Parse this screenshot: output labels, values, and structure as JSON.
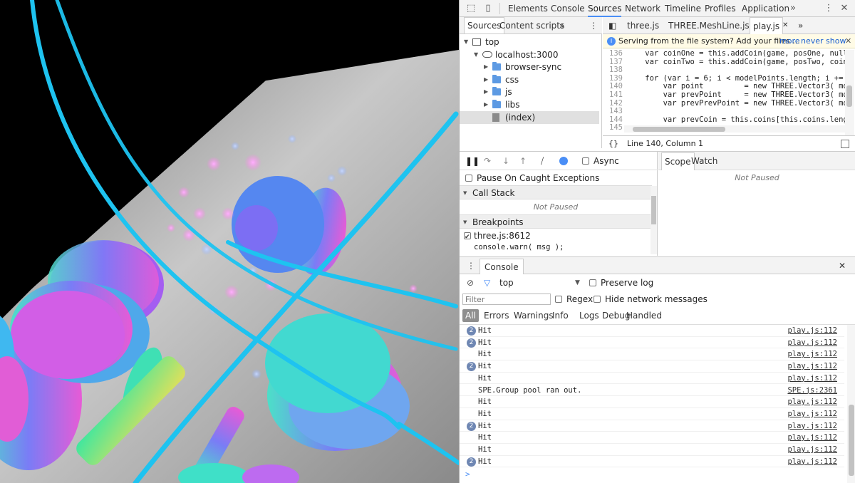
{
  "devtools": {
    "tabs": [
      "Elements",
      "Console",
      "Sources",
      "Network",
      "Timeline",
      "Profiles",
      "Application"
    ],
    "active_tab": "Sources",
    "more_tabs_icon": "»",
    "menu_icon": "⋮",
    "close_icon": "✕"
  },
  "navigator": {
    "tabs": [
      "Sources",
      "Content scripts"
    ],
    "more_icon": "»",
    "tree": [
      {
        "label": "top",
        "icon": "frame-icon",
        "depth": 0
      },
      {
        "label": "localhost:3000",
        "icon": "cloud-icon",
        "depth": 1
      },
      {
        "label": "browser-sync",
        "icon": "folder-icon",
        "depth": 2
      },
      {
        "label": "css",
        "icon": "folder-icon",
        "depth": 2
      },
      {
        "label": "js",
        "icon": "folder-icon",
        "depth": 2
      },
      {
        "label": "libs",
        "icon": "folder-icon",
        "depth": 2
      },
      {
        "label": "(index)",
        "icon": "file-icon",
        "depth": 2,
        "selected": true
      }
    ]
  },
  "editor": {
    "tabs": [
      "three.js",
      "THREE.MeshLine.js",
      "play.js"
    ],
    "active_tab": "play.js",
    "infobar_text": "Serving from the file system? Add your files ...",
    "infobar_more": "more",
    "infobar_never": "never show",
    "lines": [
      {
        "n": "136",
        "code": "    var coinOne = this.addCoin(game, posOne, null)"
      },
      {
        "n": "137",
        "code": "    var coinTwo = this.addCoin(game, posTwo, coinO"
      },
      {
        "n": "138",
        "code": ""
      },
      {
        "n": "139",
        "code": "    for (var i = 6; i < modelPoints.length; i += 3"
      },
      {
        "n": "140",
        "code": "        var point         = new THREE.Vector3( mod"
      },
      {
        "n": "141",
        "code": "        var prevPoint     = new THREE.Vector3( mod"
      },
      {
        "n": "142",
        "code": "        var prevPrevPoint = new THREE.Vector3( mod"
      },
      {
        "n": "143",
        "code": ""
      },
      {
        "n": "144",
        "code": "        var prevCoin = this.coins[this.coins.lengt"
      },
      {
        "n": "145",
        "code": ""
      }
    ],
    "status": "Line 140, Column 1",
    "format_icon": "{}"
  },
  "debugger": {
    "async_label": "Async",
    "pause_caught_label": "Pause On Caught Exceptions",
    "call_stack_label": "Call Stack",
    "call_stack_status": "Not Paused",
    "breakpoints_label": "Breakpoints",
    "breakpoint_file": "three.js:8612",
    "breakpoint_code": "console.warn( msg );",
    "scope_tab": "Scope",
    "watch_tab": "Watch",
    "scope_status": "Not Paused"
  },
  "console": {
    "title": "Console",
    "context": "top",
    "preserve_log": "Preserve log",
    "filter_placeholder": "Filter",
    "regex_label": "Regex",
    "hide_network_label": "Hide network messages",
    "levels": [
      "All",
      "Errors",
      "Warnings",
      "Info",
      "Logs",
      "Debug",
      "Handled"
    ],
    "active_level": "All",
    "messages": [
      {
        "count": "2",
        "text": "Hit",
        "source": "play.js:112"
      },
      {
        "count": "2",
        "text": "Hit",
        "source": "play.js:112"
      },
      {
        "count": "",
        "text": "Hit",
        "source": "play.js:112"
      },
      {
        "count": "2",
        "text": "Hit",
        "source": "play.js:112"
      },
      {
        "count": "",
        "text": "Hit",
        "source": "play.js:112"
      },
      {
        "count": "",
        "text": "SPE.Group pool ran out.",
        "source": "SPE.js:2361"
      },
      {
        "count": "",
        "text": "Hit",
        "source": "play.js:112"
      },
      {
        "count": "",
        "text": "Hit",
        "source": "play.js:112"
      },
      {
        "count": "2",
        "text": "Hit",
        "source": "play.js:112"
      },
      {
        "count": "",
        "text": "Hit",
        "source": "play.js:112"
      },
      {
        "count": "",
        "text": "Hit",
        "source": "play.js:112"
      },
      {
        "count": "2",
        "text": "Hit",
        "source": "play.js:112"
      }
    ],
    "prompt": ">"
  },
  "colors": {
    "accent": "#4a8ef6",
    "track": "#1ec3f0",
    "sky": "#000000",
    "ground": "#b8b8b8"
  }
}
